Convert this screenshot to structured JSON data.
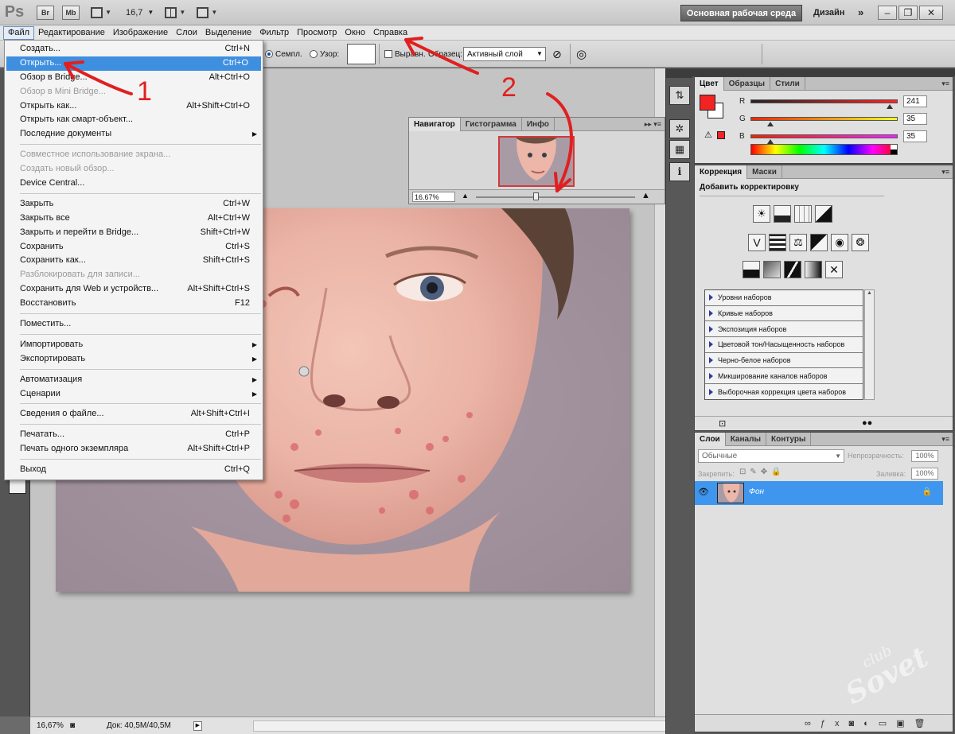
{
  "appbar": {
    "logo": "Ps",
    "bridge_chip": "Br",
    "minibridge_chip": "Mb",
    "zoom": "16,7",
    "workspace_active": "Основная рабочая среда",
    "workspace_design": "Дизайн",
    "more": "»"
  },
  "menubar": [
    "Файл",
    "Редактирование",
    "Изображение",
    "Слои",
    "Выделение",
    "Фильтр",
    "Просмотр",
    "Окно",
    "Справка"
  ],
  "options": {
    "sample_radio": "Семпл.",
    "pattern_radio": "Узор:",
    "aligned_check": "Выравн.",
    "sample_label": "Образец:",
    "sample_value": "Активный слой"
  },
  "file_menu": [
    {
      "label": "Создать...",
      "shortcut": "Ctrl+N"
    },
    {
      "label": "Открыть...",
      "shortcut": "Ctrl+O",
      "highlighted": true
    },
    {
      "label": "Обзор в Bridge...",
      "shortcut": "Alt+Ctrl+O"
    },
    {
      "label": "Обзор в Mini Bridge...",
      "shortcut": "",
      "disabled": true
    },
    {
      "label": "Открыть как...",
      "shortcut": "Alt+Shift+Ctrl+O"
    },
    {
      "label": "Открыть как смарт-объект...",
      "shortcut": ""
    },
    {
      "label": "Последние документы",
      "shortcut": "",
      "submenu": true
    },
    {
      "label": "Совместное использование экрана...",
      "shortcut": "",
      "disabled": true
    },
    {
      "label": "Создать новый обзор...",
      "shortcut": "",
      "disabled": true
    },
    {
      "label": "Device Central...",
      "shortcut": ""
    },
    {
      "label": "Закрыть",
      "shortcut": "Ctrl+W"
    },
    {
      "label": "Закрыть все",
      "shortcut": "Alt+Ctrl+W"
    },
    {
      "label": "Закрыть и перейти в Bridge...",
      "shortcut": "Shift+Ctrl+W"
    },
    {
      "label": "Сохранить",
      "shortcut": "Ctrl+S"
    },
    {
      "label": "Сохранить как...",
      "shortcut": "Shift+Ctrl+S"
    },
    {
      "label": "Разблокировать для записи...",
      "shortcut": "",
      "disabled": true
    },
    {
      "label": "Сохранить для Web и устройств...",
      "shortcut": "Alt+Shift+Ctrl+S"
    },
    {
      "label": "Восстановить",
      "shortcut": "F12"
    },
    {
      "label": "Поместить...",
      "shortcut": ""
    },
    {
      "label": "Импортировать",
      "shortcut": "",
      "submenu": true
    },
    {
      "label": "Экспортировать",
      "shortcut": "",
      "submenu": true
    },
    {
      "label": "Автоматизация",
      "shortcut": "",
      "submenu": true
    },
    {
      "label": "Сценарии",
      "shortcut": "",
      "submenu": true
    },
    {
      "label": "Сведения о файле...",
      "shortcut": "Alt+Shift+Ctrl+I"
    },
    {
      "label": "Печатать...",
      "shortcut": "Ctrl+P"
    },
    {
      "label": "Печать одного экземпляра",
      "shortcut": "Alt+Shift+Ctrl+P"
    },
    {
      "label": "Выход",
      "shortcut": "Ctrl+Q"
    }
  ],
  "navigator": {
    "tabs": [
      "Навигатор",
      "Гистограмма",
      "Инфо"
    ],
    "zoom": "16.67%",
    "zoom_level": 0.38
  },
  "color_panel": {
    "tabs": [
      "Цвет",
      "Образцы",
      "Стили"
    ],
    "foreground": "#f12323",
    "background": "#ffffff",
    "channels": [
      {
        "label": "R",
        "value": "241",
        "level": 0.945
      },
      {
        "label": "G",
        "value": "35",
        "level": 0.137
      },
      {
        "label": "B",
        "value": "35",
        "level": 0.137
      }
    ]
  },
  "adjustments": {
    "tabs": [
      "Коррекция",
      "Маски"
    ],
    "title": "Добавить корректировку",
    "presets": [
      "Уровни наборов",
      "Кривые наборов",
      "Экспозиция наборов",
      "Цветовой тон/Насыщенность наборов",
      "Черно-белое наборов",
      "Микширование каналов наборов",
      "Выборочная коррекция цвета наборов"
    ]
  },
  "layers": {
    "tabs": [
      "Слои",
      "Каналы",
      "Контуры"
    ],
    "blend_mode": "Обычные",
    "opacity_label": "Непрозрачность:",
    "opacity": "100%",
    "lock_label": "Закрепить:",
    "fill_label": "Заливка:",
    "fill": "100%",
    "layer_name": "Фон"
  },
  "status": {
    "zoom": "16,67%",
    "doc": "Док: 40,5M/40,5M"
  },
  "annotations": {
    "one": "1",
    "two": "2"
  },
  "watermark": {
    "line1": "club",
    "line2": "Sovet"
  },
  "colors": {
    "accent": "#3f8fe0",
    "annotation": "#e02020"
  }
}
